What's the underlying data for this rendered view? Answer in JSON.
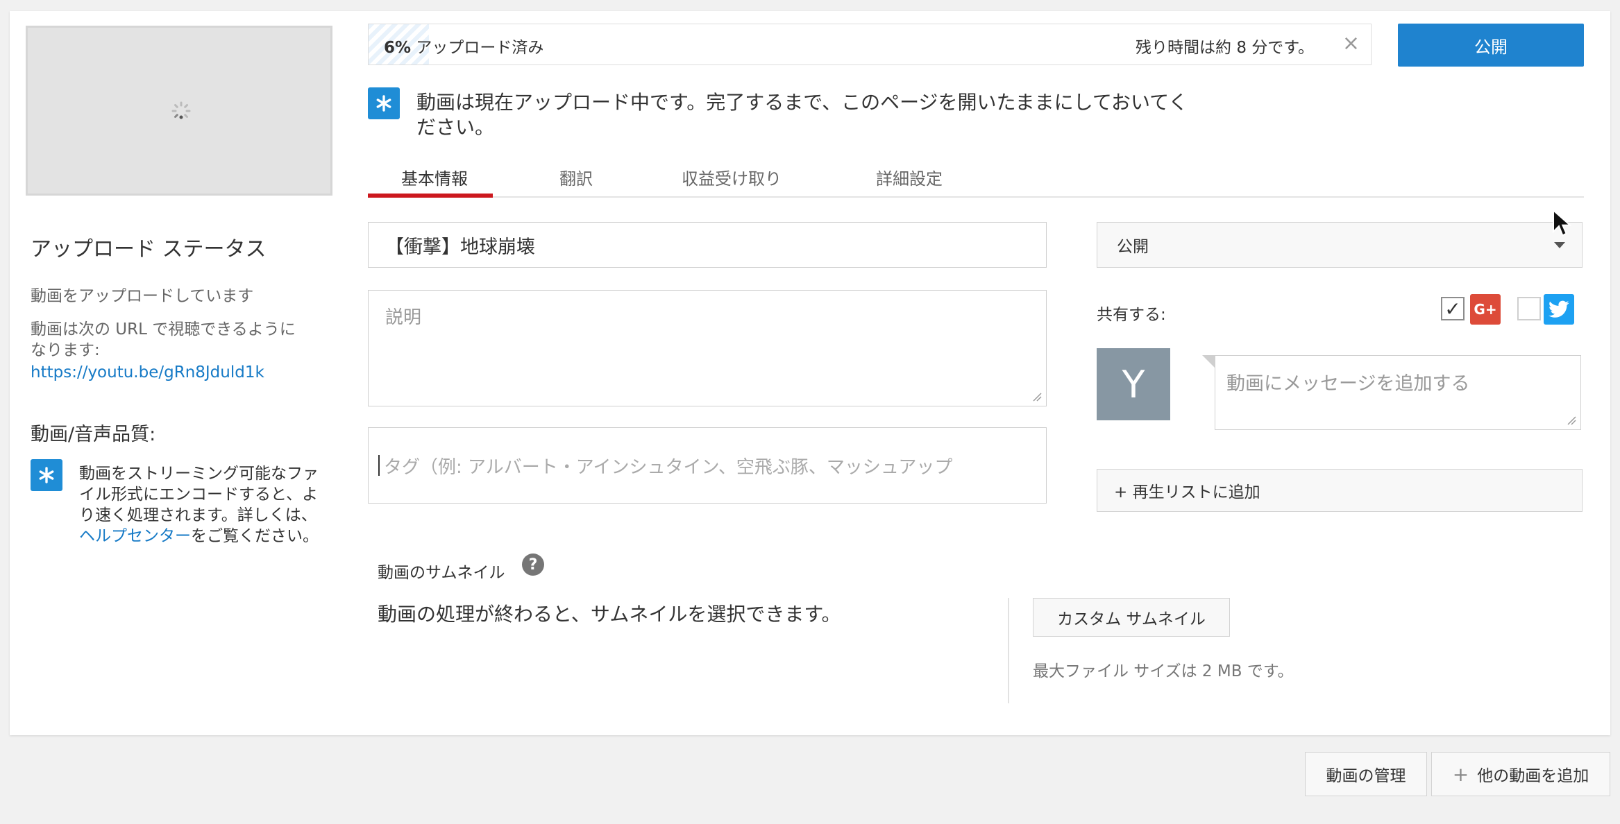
{
  "upload": {
    "progress_percent": "6%",
    "progress_fraction": 0.06,
    "progress_label": "アップロード済み",
    "remaining": "残り時間は約 8 分です。",
    "close": "×",
    "info_message": "動画は現在アップロード中です。完了するまで、このページを開いたままにしておいてください。"
  },
  "publish_button": "公開",
  "tabs": [
    {
      "label": "基本情報"
    },
    {
      "label": "翻訳"
    },
    {
      "label": "収益受け取り"
    },
    {
      "label": "詳細設定"
    }
  ],
  "sidebar": {
    "status_title": "アップロード ステータス",
    "status_line1": "動画をアップロードしています",
    "status_line2": "動画は次の URL で視聴できるように",
    "status_line3": "なります:",
    "url": "https://youtu.be/gRn8Jduld1k",
    "quality_title": "動画/音声品質:",
    "tip_text": "動画をストリーミング可能なファイル形式にエンコードすると、より速く処理されます。詳しくは、",
    "tip_link": "ヘルプセンター",
    "tip_suffix": "をご覧ください。"
  },
  "form": {
    "title_value": "【衝撃】地球崩壊",
    "description_placeholder": "説明",
    "tags_placeholder": "タグ（例: アルバート・アインシュタイン、空飛ぶ豚、マッシュアップ",
    "privacy_value": "公開",
    "share_label": "共有する:",
    "avatar_letter": "Y",
    "message_placeholder": "動画にメッセージを追加する",
    "playlist_button": "+ 再生リストに追加"
  },
  "thumbnails": {
    "label": "動画のサムネイル",
    "help": "?",
    "message": "動画の処理が終わると、サムネイルを選択できます。",
    "custom_button": "カスタム サムネイル",
    "max_size": "最大ファイル サイズは 2 MB です。"
  },
  "footer": {
    "manage_button": "動画の管理",
    "add_plus": "+",
    "add_button": "他の動画を追加"
  },
  "icons": {
    "gplus": "G+",
    "check": "✓"
  },
  "colors": {
    "accent": "#1f83cf",
    "tab_active": "#cc181e",
    "link": "#167ac6"
  }
}
